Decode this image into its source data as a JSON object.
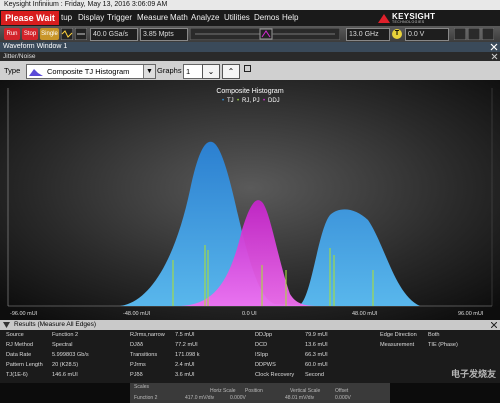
{
  "titlebar": {
    "text": "Keysight Infiniium : Friday, May 13, 2016 3:06:09 AM"
  },
  "menubar": {
    "please_wait": "Please Wait",
    "items": [
      "tup",
      "Display",
      "Trigger",
      "Measure",
      "Math",
      "Analyze",
      "Utilities",
      "Demos",
      "Help"
    ],
    "brand": "KEYSIGHT",
    "brand_sub": "TECHNOLOGIES"
  },
  "toolbar": {
    "run_label": "Run",
    "stop_label": "Stop",
    "single_label": "Single",
    "sample_rate": "40.0 GSa/s",
    "memory_depth": "3.85 Mpts",
    "bandwidth": "13.0 GHz",
    "trigger_badge": "T",
    "trigger_level": "0.0 V",
    "colors": {
      "run": "#d3232a",
      "stop": "#d3232a",
      "single": "#c89528"
    }
  },
  "window": {
    "title": "Waveform Window 1",
    "subtitle": "Jitter/Noise"
  },
  "typebar": {
    "type_label": "Type",
    "type_value": "Composite TJ Histogram",
    "graphs_label": "Graphs",
    "graphs_value": "1"
  },
  "plot": {
    "title": "Composite Histogram",
    "legend": [
      "TJ",
      "RJ, PJ",
      "DDJ"
    ],
    "x_ticks": [
      "-96.00 mUI",
      "-48.00 mUI",
      "0.0 UI",
      "48.00 mUI",
      "96.00 mUI"
    ],
    "colors": {
      "tj": "#2e8fd8",
      "ddj": "#d42bd4",
      "rjpj": "#9ad23c"
    }
  },
  "results": {
    "header": "Results   (Measure All Edges)",
    "col1": [
      [
        "Source",
        "Function 2"
      ],
      [
        "RJ Method",
        "Spectral"
      ],
      [
        "Data Rate",
        "5.999803 Gb/s"
      ],
      [
        "Pattern Length",
        "20 (K28.5)"
      ],
      [
        "TJ(1E-6)",
        "146.6 mUI"
      ]
    ],
    "col2": [
      [
        "RJrms,narrow",
        "7.5 mUI"
      ],
      [
        "DJδδ",
        "77.2 mUI"
      ],
      [
        "Transitions",
        "171.098 k"
      ],
      [
        "PJrms",
        "2.4 mUI"
      ],
      [
        "PJδδ",
        "3.6 mUI"
      ]
    ],
    "col3": [
      [
        "DDJpp",
        "79.9 mUI"
      ],
      [
        "DCD",
        "13.6 mUI"
      ],
      [
        "ISIpp",
        "66.3 mUI"
      ],
      [
        "DDPWS",
        "60.0 mUI"
      ],
      [
        "Clock Recovery",
        "Second"
      ]
    ],
    "col4": [
      [
        "Edge Direction",
        "Both"
      ],
      [
        "Measurement",
        "TIE (Phase)"
      ]
    ]
  },
  "scales": {
    "title": "Scales",
    "headers": [
      "Horiz Scale",
      "Position",
      "Vertical Scale",
      "Offset"
    ],
    "row_label": "Function 2",
    "row_values": [
      "417.0 mV/div",
      "0.000V",
      "48.01 mV/div",
      "0.000V"
    ]
  },
  "watermark": "电子发烧友"
}
